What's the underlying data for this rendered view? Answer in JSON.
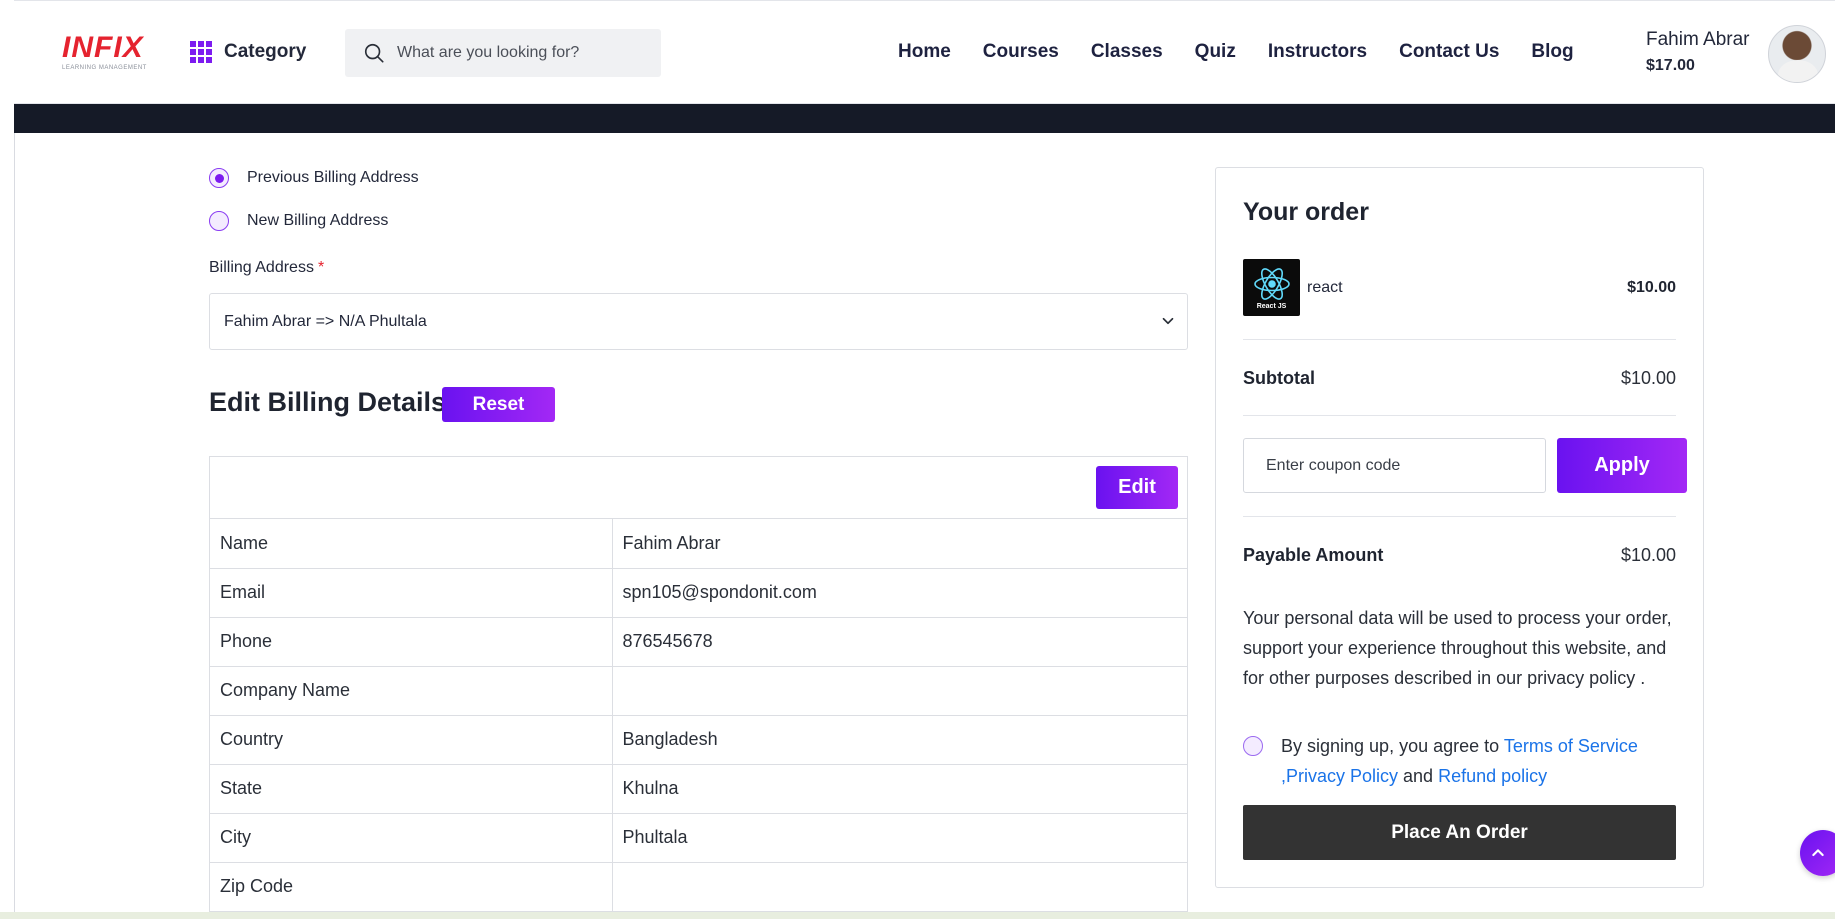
{
  "header": {
    "logo_text": "INFIX",
    "logo_subtitle": "LEARNING MANAGEMENT",
    "category_label": "Category",
    "search_placeholder": "What are you looking for?",
    "nav": [
      "Home",
      "Courses",
      "Classes",
      "Quiz",
      "Instructors",
      "Contact Us",
      "Blog"
    ],
    "user_name": "Fahim Abrar",
    "user_balance": "$17.00"
  },
  "billing": {
    "options": [
      {
        "label": "Previous Billing Address",
        "selected": true
      },
      {
        "label": "New Billing Address",
        "selected": false
      }
    ],
    "address_label": "Billing Address",
    "required_mark": "*",
    "selected_address": "Fahim Abrar => N/A Phultala"
  },
  "edit_details": {
    "title": "Edit Billing Details",
    "reset_label": "Reset",
    "edit_label": "Edit",
    "rows": [
      {
        "key": "Name",
        "value": "Fahim Abrar"
      },
      {
        "key": "Email",
        "value": "spn105@spondonit.com"
      },
      {
        "key": "Phone",
        "value": "876545678"
      },
      {
        "key": "Company Name",
        "value": ""
      },
      {
        "key": "Country",
        "value": "Bangladesh"
      },
      {
        "key": "State",
        "value": "Khulna"
      },
      {
        "key": "City",
        "value": "Phultala"
      },
      {
        "key": "Zip Code",
        "value": ""
      }
    ]
  },
  "order": {
    "title": "Your order",
    "product_thumb_caption": "React JS",
    "product_name": "react",
    "product_price": "$10.00",
    "subtotal_label": "Subtotal",
    "subtotal_value": "$10.00",
    "coupon_placeholder": "Enter coupon code",
    "apply_label": "Apply",
    "payable_label": "Payable Amount",
    "payable_value": "$10.00",
    "privacy_text": "Your personal data will be used to process your order, support your experience throughout this website, and for other purposes described in our privacy policy .",
    "agree_prefix": "By signing up, you agree to ",
    "terms_link": "Terms of Service",
    "privacy_link": ",Privacy Policy",
    "and_text": " and ",
    "refund_link": "Refund policy",
    "place_order_label": "Place An Order"
  },
  "colors": {
    "accent": "#7d1bf0",
    "accent_gradient_end": "#a328f5",
    "dark_band": "#151a27",
    "order_button": "#333333",
    "link": "#1a73e8",
    "logo_red": "#e5232f"
  },
  "icons": [
    "grid-icon",
    "search-icon",
    "chevron-down-icon",
    "react-logo-icon",
    "arrow-up-icon"
  ]
}
